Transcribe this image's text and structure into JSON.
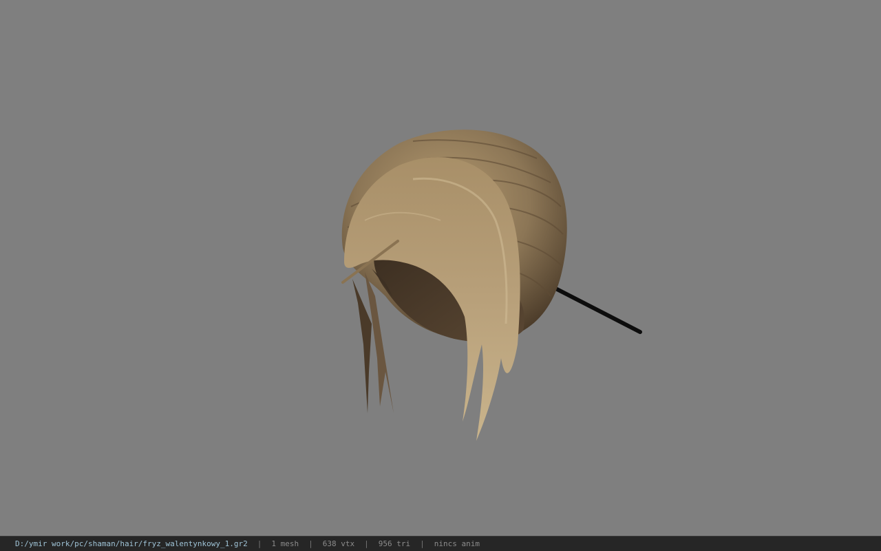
{
  "viewer": {
    "background_color": "#7f7f7f",
    "model_icon": "hair-model-render",
    "colors": {
      "hair_light": "#b39a72",
      "hair_mid": "#8a7555",
      "hair_dark": "#4e3e2c",
      "hair_pin": "#0d0d0d"
    }
  },
  "status": {
    "file_path": "D:/ymir work/pc/shaman/hair/fryz_walentynkowy_1.gr2",
    "separator": "|",
    "mesh_count": "1 mesh",
    "vertex_count": "638 vtx",
    "triangle_count": "956 tri",
    "anim_status": "nincs anim"
  }
}
